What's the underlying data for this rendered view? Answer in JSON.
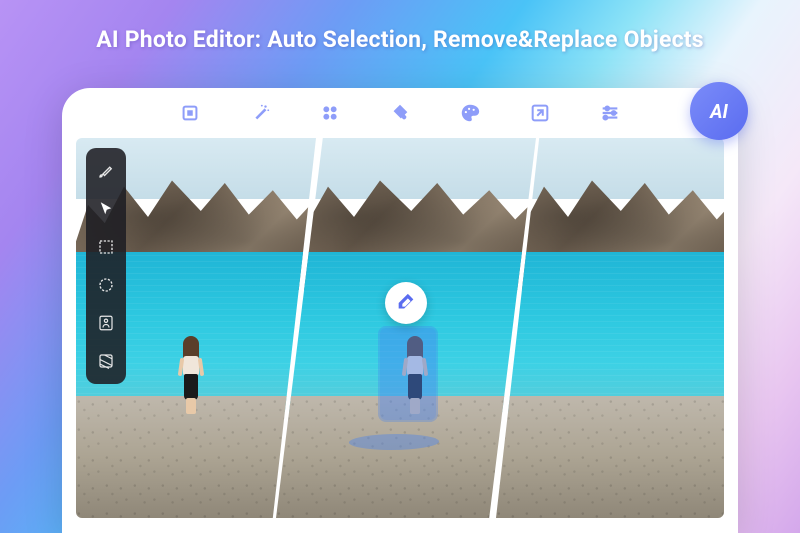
{
  "headline": "AI Photo Editor: Auto Selection, Remove&Replace Objects",
  "ai_badge": {
    "label": "AI"
  },
  "top_tools": [
    {
      "name": "crop-icon"
    },
    {
      "name": "magic-wand-icon"
    },
    {
      "name": "clone-icon"
    },
    {
      "name": "paint-bucket-icon"
    },
    {
      "name": "palette-icon"
    },
    {
      "name": "resize-icon"
    },
    {
      "name": "sliders-icon"
    }
  ],
  "side_tools": [
    {
      "name": "brush-icon"
    },
    {
      "name": "pointer-icon"
    },
    {
      "name": "rect-select-icon"
    },
    {
      "name": "ellipse-select-icon"
    },
    {
      "name": "person-select-icon"
    },
    {
      "name": "texture-icon"
    }
  ],
  "colors": {
    "accent": "#7b8cf9",
    "toolbar_icon": "#7b8cf9"
  }
}
